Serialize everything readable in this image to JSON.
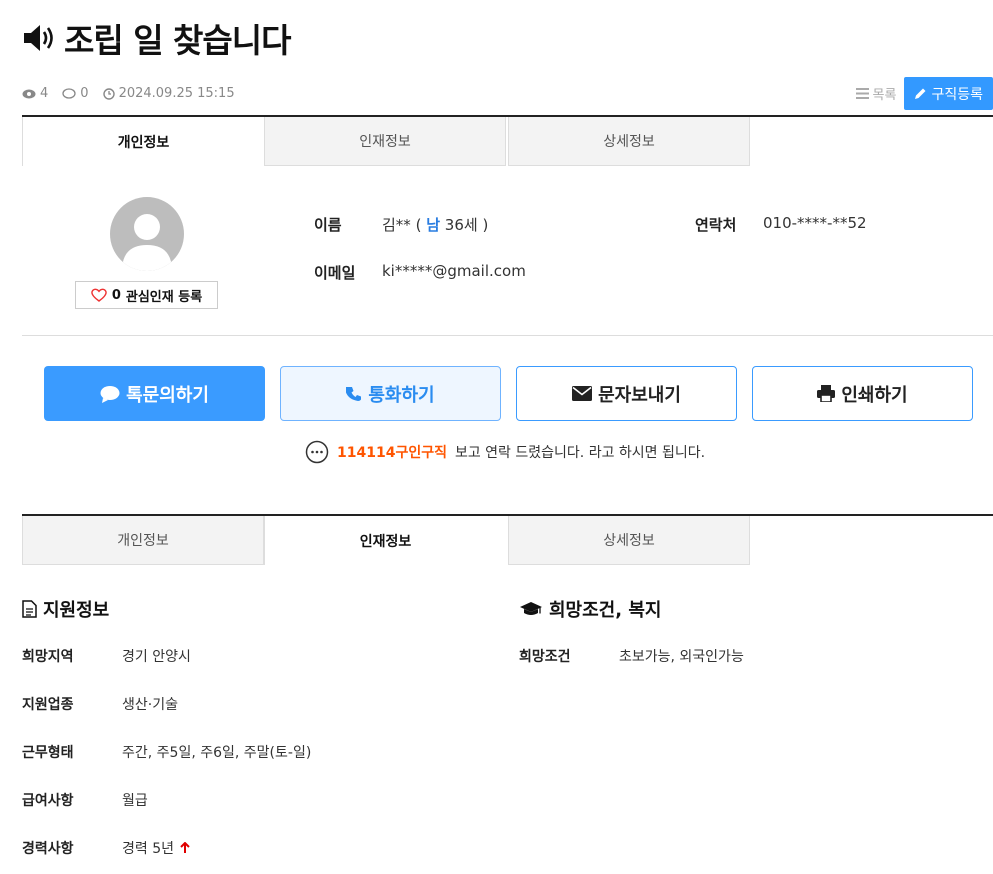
{
  "post": {
    "title": "조립 일 찾습니다",
    "views": "4",
    "comments": "0",
    "datetime": "2024.09.25 15:15"
  },
  "actions": {
    "list_label": "목록",
    "register_label": "구직등록"
  },
  "tabs": [
    "개인정보",
    "인재정보",
    "상세정보"
  ],
  "profile": {
    "fav_count": "0",
    "fav_label": "관심인재 등록",
    "name_label": "이름",
    "name_prefix": "김** (",
    "gender": "남",
    "age": "36세 )",
    "contact_label": "연락처",
    "contact_value": "010-****-**52",
    "email_label": "이메일",
    "email_value": "ki*****@gmail.com"
  },
  "buttons": {
    "talk": "톡문의하기",
    "call": "통화하기",
    "sms": "문자보내기",
    "print": "인쇄하기"
  },
  "notice": {
    "brand": "114114구인구직",
    "text": "보고 연락 드렸습니다. 라고 하시면 됩니다."
  },
  "support": {
    "title": "지원정보",
    "rows": [
      {
        "label": "희망지역",
        "value": "경기 안양시"
      },
      {
        "label": "지원업종",
        "value": "생산·기술"
      },
      {
        "label": "근무형태",
        "value": "주간, 주5일, 주6일, 주말(토-일)"
      },
      {
        "label": "급여사항",
        "value": "월급"
      },
      {
        "label": "경력사항",
        "value": "경력 5년"
      }
    ]
  },
  "wish": {
    "title": "희망조건, 복지",
    "rows": [
      {
        "label": "희망조건",
        "value": "초보가능, 외국인가능"
      }
    ]
  },
  "colors": {
    "accent": "#3a9bff",
    "brand": "#ff5500",
    "arrow": "#e00000"
  }
}
